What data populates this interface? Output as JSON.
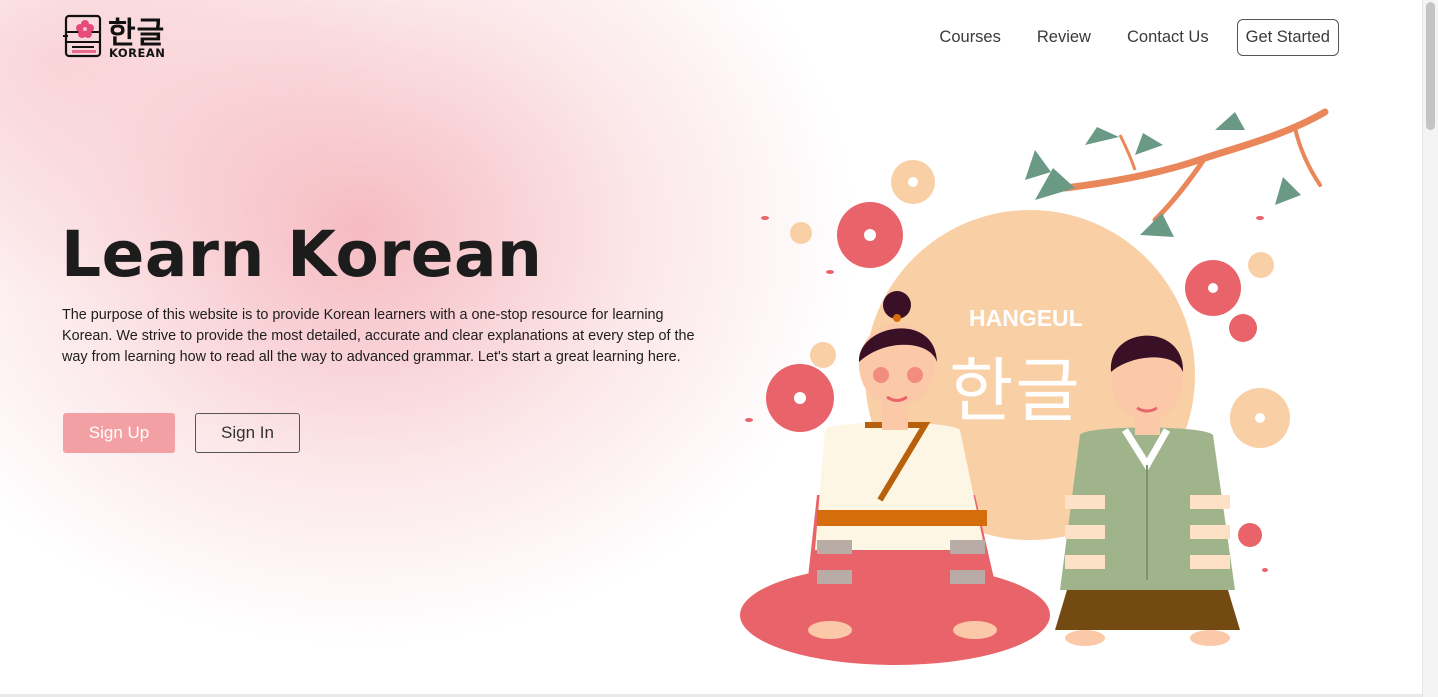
{
  "logo": {
    "hangul": "한글",
    "word": "KOREAN"
  },
  "nav": {
    "courses": "Courses",
    "review": "Review",
    "contact": "Contact Us",
    "get_started": "Get Started"
  },
  "hero": {
    "title": "Learn Korean",
    "description": "The purpose of this website is to provide Korean learners with a one-stop resource for learning Korean. We strive to provide the most detailed, accurate and clear explanations at every step of the way from learning how to read all the way to advanced grammar. Let's start a great learning here.",
    "signup": "Sign Up",
    "signin": "Sign In"
  },
  "illustration": {
    "label": "HANGEUL",
    "hangul": "한글"
  },
  "colors": {
    "accent": "#f2a0a3",
    "coral": "#e86a67",
    "peach": "#f9cfa5",
    "sage": "#9db48a"
  }
}
